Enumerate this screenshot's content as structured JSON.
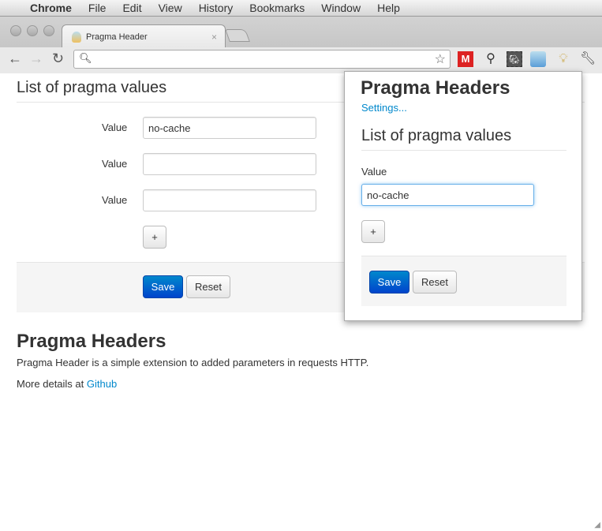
{
  "menubar": {
    "app": "Chrome",
    "items": [
      "File",
      "Edit",
      "View",
      "History",
      "Bookmarks",
      "Window",
      "Help"
    ]
  },
  "tab": {
    "title": "Pragma Header",
    "close": "×"
  },
  "omnibox": {
    "value": "",
    "placeholder": ""
  },
  "page": {
    "section_title": "List of pragma values",
    "fields": [
      {
        "label": "Value",
        "value": "no-cache"
      },
      {
        "label": "Value",
        "value": ""
      },
      {
        "label": "Value",
        "value": ""
      }
    ],
    "add_label": "+",
    "save_label": "Save",
    "reset_label": "Reset",
    "about_title": "Pragma Headers",
    "about_text": "Pragma Header is a simple extension to added parameters in requests HTTP.",
    "more_prefix": "More details at ",
    "more_link": "Github"
  },
  "popup": {
    "title": "Pragma Headers",
    "settings_link": "Settings...",
    "section_title": "List of pragma values",
    "field_label": "Value",
    "field_value": "no-cache",
    "add_label": "+",
    "save_label": "Save",
    "reset_label": "Reset"
  }
}
